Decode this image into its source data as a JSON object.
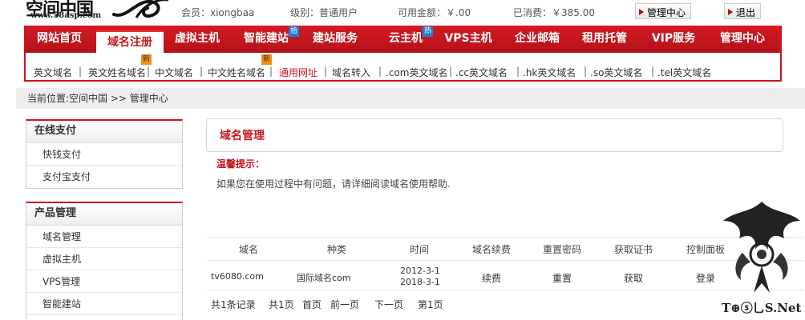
{
  "header": {
    "logo_text": "空间中国",
    "logo_url": "www.58asp.com",
    "member": "会员：xiongbaa",
    "level": "级别：普通用户",
    "balance": "可用金额：￥.00",
    "spent": "已消费：￥385.00",
    "btn_manage": "管理中心",
    "btn_logout": "退出"
  },
  "nav": {
    "items": [
      {
        "label": "网站首页"
      },
      {
        "label": "域名注册"
      },
      {
        "label": "虚拟主机"
      },
      {
        "label": "智能建站",
        "tag": "拾"
      },
      {
        "label": "建站服务"
      },
      {
        "label": "云主机",
        "tag": "热"
      },
      {
        "label": "VPS主机"
      },
      {
        "label": "企业邮箱"
      },
      {
        "label": "租用托管"
      },
      {
        "label": "VIP服务"
      },
      {
        "label": "管理中心"
      }
    ],
    "sub": [
      {
        "label": "英文域名"
      },
      {
        "label": "英文姓名域名",
        "tag": "新"
      },
      {
        "label": "中文域名"
      },
      {
        "label": "中文姓名域名",
        "tag": "新"
      },
      {
        "label": "通用网址"
      },
      {
        "label": "域名转入"
      },
      {
        "label": ".com英文域名"
      },
      {
        "label": ".cc英文域名"
      },
      {
        "label": ".hk英文域名"
      },
      {
        "label": ".so英文域名"
      },
      {
        "label": ".tel英文域名"
      }
    ]
  },
  "breadcrumb": "当前位置:空间中国 >> 管理中心",
  "sidebar": {
    "pay": {
      "title": "在线支付",
      "items": [
        "快钱支付",
        "支付宝支付"
      ]
    },
    "products": {
      "title": "产品管理",
      "items": [
        "域名管理",
        "虚拟主机",
        "VPS管理",
        "智能建站"
      ]
    }
  },
  "main": {
    "title": "域名管理",
    "tip_title": "温馨提示：",
    "tip_text": "如果您在使用过程中有问题，请详细阅读域名使用帮助.",
    "table": {
      "headers": [
        "域名",
        "种类",
        "时间",
        "域名续费",
        "重置密码",
        "获取证书",
        "控制面板"
      ],
      "row": {
        "domain": "tv6080.com",
        "type": "国际域名com",
        "date1": "2012-3-1",
        "date2": "2018-3-1",
        "renew": "续费",
        "reset": "重置",
        "cert": "获取",
        "panel": "登录"
      }
    },
    "pager": {
      "total": "共1条记录",
      "pages": "共1页",
      "first": "首页",
      "prev": "前一页",
      "next": "下一页",
      "current": "第1页"
    }
  },
  "watermark": "T⊕ⓢ乚S.Net",
  "colors": {
    "brand_red": "#c8161d",
    "tag_blue": "#1d7fd6",
    "tag_orange": "#f39019"
  }
}
